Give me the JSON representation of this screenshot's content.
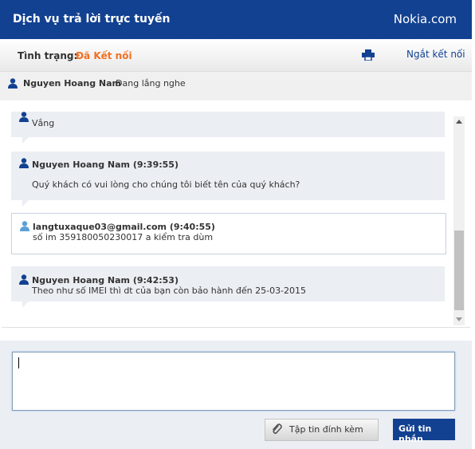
{
  "header": {
    "title": "Dịch vụ trả lời trực tuyến",
    "brand": "Nokia.com"
  },
  "status": {
    "label": "Tình trạng:",
    "value": "Đã Kết nối",
    "disconnect_label": "Ngắt kết nối"
  },
  "agent_bar": {
    "name": "Nguyen Hoang Nam",
    "state": "Đang lắng nghe"
  },
  "messages": [
    {
      "sender": "agent",
      "name": "",
      "text": "Vắng"
    },
    {
      "sender": "agent",
      "name": "Nguyen Hoang Nam (9:39:55)",
      "text": "Quý khách có vui lòng cho chúng tôi biết tên của quý khách?"
    },
    {
      "sender": "visitor",
      "name": "langtuxaque03@gmail.com (9:40:55)",
      "text": "số im 359180050230017 a kiểm tra dùm"
    },
    {
      "sender": "agent",
      "name": "Nguyen Hoang Nam (9:42:53)",
      "text": "Theo như số IMEI thì dt của bạn còn bảo hành đến 25-03-2015"
    }
  ],
  "composer": {
    "input_value": "",
    "attach_label": "Tập tin đính kèm",
    "send_label": "Gửi tin nhắn"
  },
  "icons": {
    "print": "printer-icon",
    "user": "user-icon",
    "attach": "paperclip-icon"
  },
  "colors": {
    "brand_blue": "#124191",
    "status_orange": "#f36f21",
    "bubble_bg": "#ebeef3",
    "visitor_icon": "#5aa0d8"
  }
}
